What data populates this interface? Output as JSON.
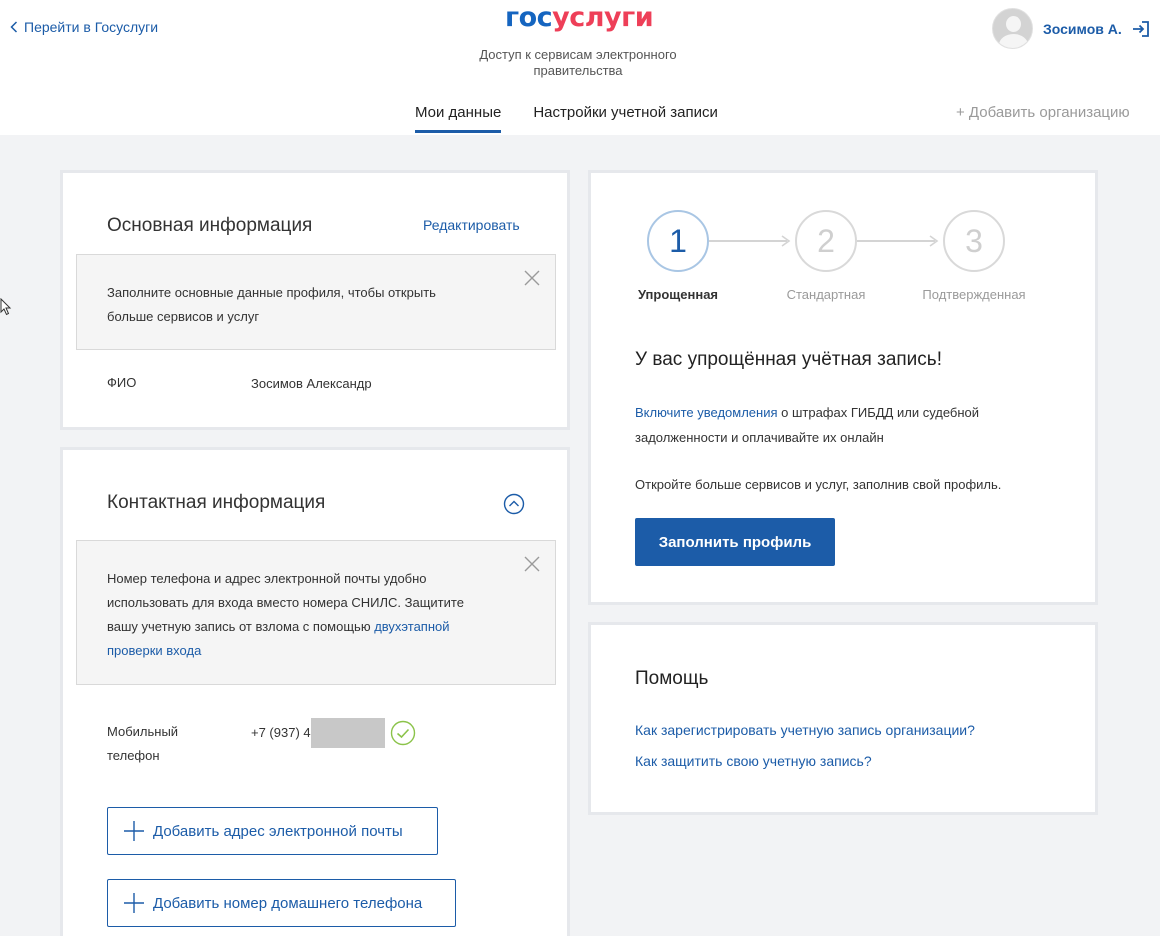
{
  "header": {
    "back_link": "Перейти в Госуслуги",
    "logo_part1": "гос",
    "logo_part2": "услуги",
    "subtitle": "Доступ к сервисам электронного правительства",
    "user_name": "Зосимов А.",
    "tabs": [
      "Мои данные",
      "Настройки учетной записи"
    ],
    "add_org": "+ Добавить организацию"
  },
  "basic_info": {
    "title": "Основная информация",
    "edit": "Редактировать",
    "notice": "Заполните основные данные профиля, чтобы открыть больше сервисов и услуг",
    "fio_label": "ФИО",
    "fio_value": "Зосимов Александр"
  },
  "contact_info": {
    "title": "Контактная информация",
    "notice_text": "Номер телефона и адрес электронной почты удобно использовать для входа вместо номера СНИЛС. Защитите вашу учетную запись от взлома с помощью",
    "notice_link": "двухэтапной проверки входа",
    "phone_label_1": "Мобильный",
    "phone_label_2": "телефон",
    "phone_value": "+7 (937) 4",
    "add_email": "Добавить адрес электронной почты",
    "add_home_phone": "Добавить номер домашнего телефона"
  },
  "account_level": {
    "steps": [
      {
        "num": "1",
        "label": "Упрощенная"
      },
      {
        "num": "2",
        "label": "Стандартная"
      },
      {
        "num": "3",
        "label": "Подтвержденная"
      }
    ],
    "title": "У вас упрощённая учётная запись!",
    "notify_link": "Включите уведомления",
    "notify_text": " о штрафах ГИБДД или судебной задолженности и оплачивайте их онлайн",
    "more_text": "Откройте больше сервисов и услуг, заполнив свой профиль.",
    "fill_button": "Заполнить профиль"
  },
  "help": {
    "title": "Помощь",
    "links": [
      "Как зарегистрировать учетную запись организации?",
      "Как защитить свою учетную запись?"
    ]
  },
  "colors": {
    "accent": "#1c5ca8",
    "logo_red": "#ee3f58",
    "success": "#8bc34a"
  }
}
